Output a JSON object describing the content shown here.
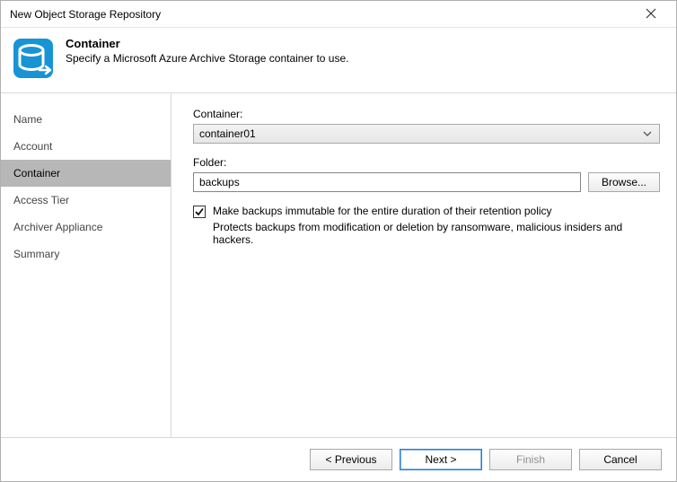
{
  "window": {
    "title": "New Object Storage Repository"
  },
  "header": {
    "title": "Container",
    "subtitle": "Specify a Microsoft Azure Archive Storage container to use."
  },
  "sidebar": {
    "items": [
      {
        "label": "Name"
      },
      {
        "label": "Account"
      },
      {
        "label": "Container"
      },
      {
        "label": "Access Tier"
      },
      {
        "label": "Archiver Appliance"
      },
      {
        "label": "Summary"
      }
    ],
    "active_index": 2
  },
  "form": {
    "container_label": "Container:",
    "container_value": "container01",
    "folder_label": "Folder:",
    "folder_value": "backups",
    "browse_label": "Browse...",
    "immutable": {
      "checked": true,
      "label": "Make backups immutable for the entire duration of their retention policy",
      "description": "Protects backups from modification or deletion by ransomware, malicious insiders and hackers."
    }
  },
  "footer": {
    "previous": "< Previous",
    "next": "Next >",
    "finish": "Finish",
    "cancel": "Cancel"
  }
}
